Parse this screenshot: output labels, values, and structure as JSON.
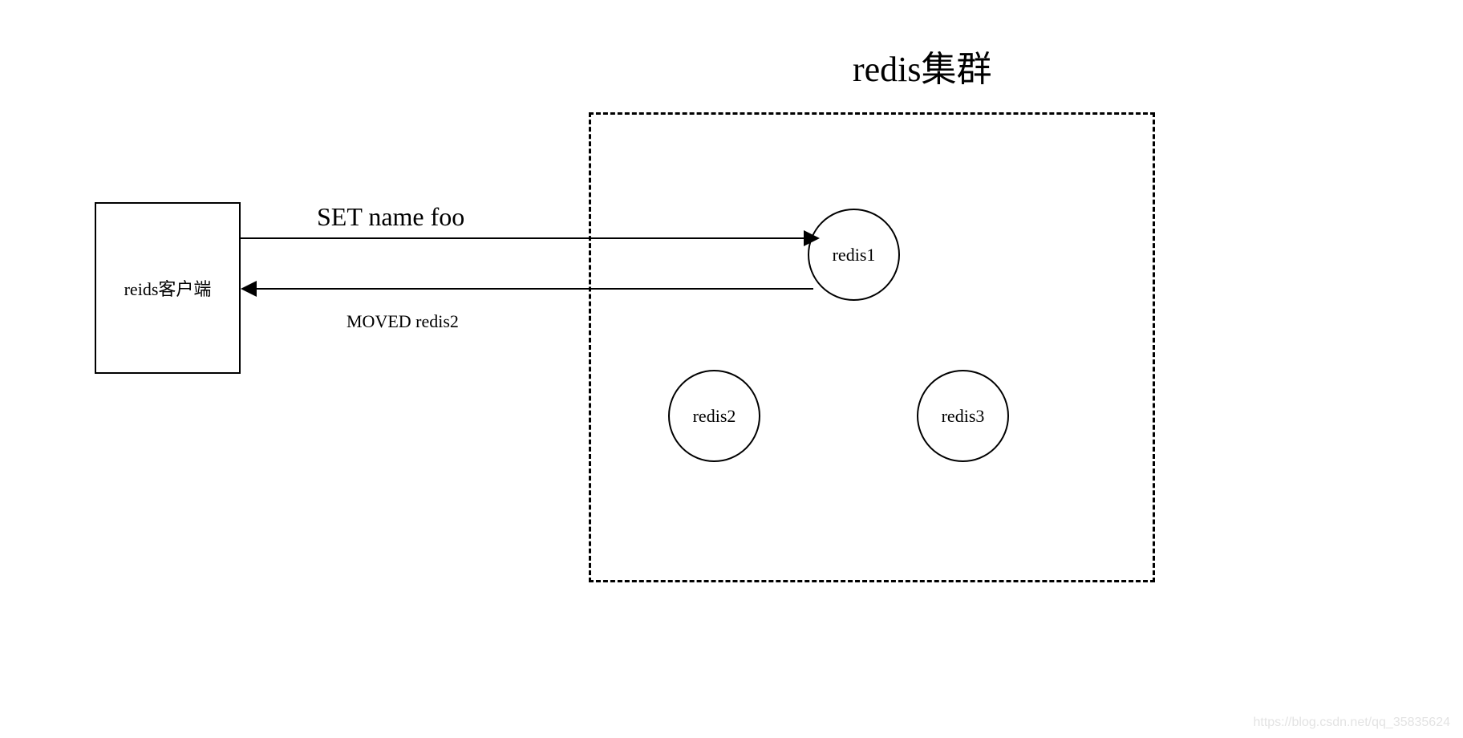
{
  "cluster": {
    "title": "redis集群",
    "nodes": {
      "n1": "redis1",
      "n2": "redis2",
      "n3": "redis3"
    }
  },
  "client": {
    "label": "reids客户端"
  },
  "messages": {
    "send": "SET name foo",
    "recv": "MOVED redis2"
  },
  "watermark": "https://blog.csdn.net/qq_35835624"
}
